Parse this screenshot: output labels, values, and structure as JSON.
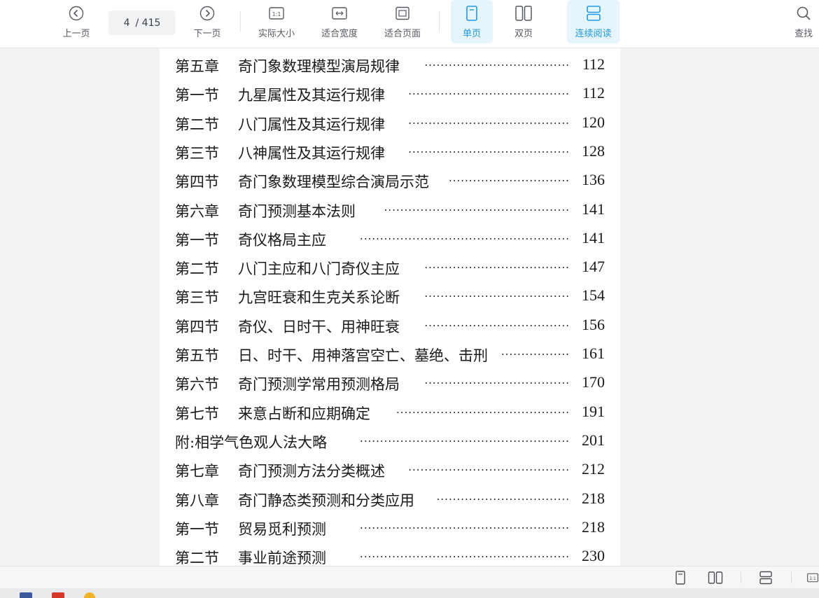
{
  "toolbar": {
    "prev_label": "上一页",
    "next_label": "下一页",
    "page_current": "4",
    "page_total": "/ 415",
    "actual_size_label": "实际大小",
    "fit_width_label": "适合宽度",
    "fit_page_label": "适合页面",
    "single_page_label": "单页",
    "double_page_label": "双页",
    "continuous_label": "连续阅读",
    "search_label": "查找",
    "accent_color": "#1f9bde"
  },
  "toc": [
    {
      "section": "第五章",
      "title": "奇门象数理模型演局规律",
      "page": "112"
    },
    {
      "section": "第一节",
      "title": "九星属性及其运行规律",
      "page": "112"
    },
    {
      "section": "第二节",
      "title": "八门属性及其运行规律",
      "page": "120"
    },
    {
      "section": "第三节",
      "title": "八神属性及其运行规律",
      "page": "128"
    },
    {
      "section": "第四节",
      "title": "奇门象数理模型综合演局示范",
      "page": "136"
    },
    {
      "section": "第六章",
      "title": "奇门预测基本法则",
      "page": "141"
    },
    {
      "section": "第一节",
      "title": "奇仪格局主应",
      "page": "141"
    },
    {
      "section": "第二节",
      "title": "八门主应和八门奇仪主应",
      "page": "147"
    },
    {
      "section": "第三节",
      "title": "九宫旺衰和生克关系论断",
      "page": "154"
    },
    {
      "section": "第四节",
      "title": "奇仪、日时干、用神旺衰",
      "page": "156"
    },
    {
      "section": "第五节",
      "title": "日、时干、用神落宫空亡、墓绝、击刑",
      "page": "161"
    },
    {
      "section": "第六节",
      "title": "奇门预测学常用预测格局",
      "page": "170"
    },
    {
      "section": "第七节",
      "title": "来意占断和应期确定",
      "page": "191"
    },
    {
      "section": "",
      "title": "附:相学气色观人法大略",
      "page": "201"
    },
    {
      "section": "第七章",
      "title": "奇门预测方法分类概述",
      "page": "212"
    },
    {
      "section": "第八章",
      "title": "奇门静态类预测和分类应用",
      "page": "218"
    },
    {
      "section": "第一节",
      "title": "贸易觅利预测",
      "page": "218"
    },
    {
      "section": "第二节",
      "title": "事业前途预测",
      "page": "230"
    }
  ],
  "statusbar": {
    "icons": [
      "single-page-icon",
      "double-page-icon",
      "continuous-icon",
      "actual-size-icon"
    ]
  }
}
